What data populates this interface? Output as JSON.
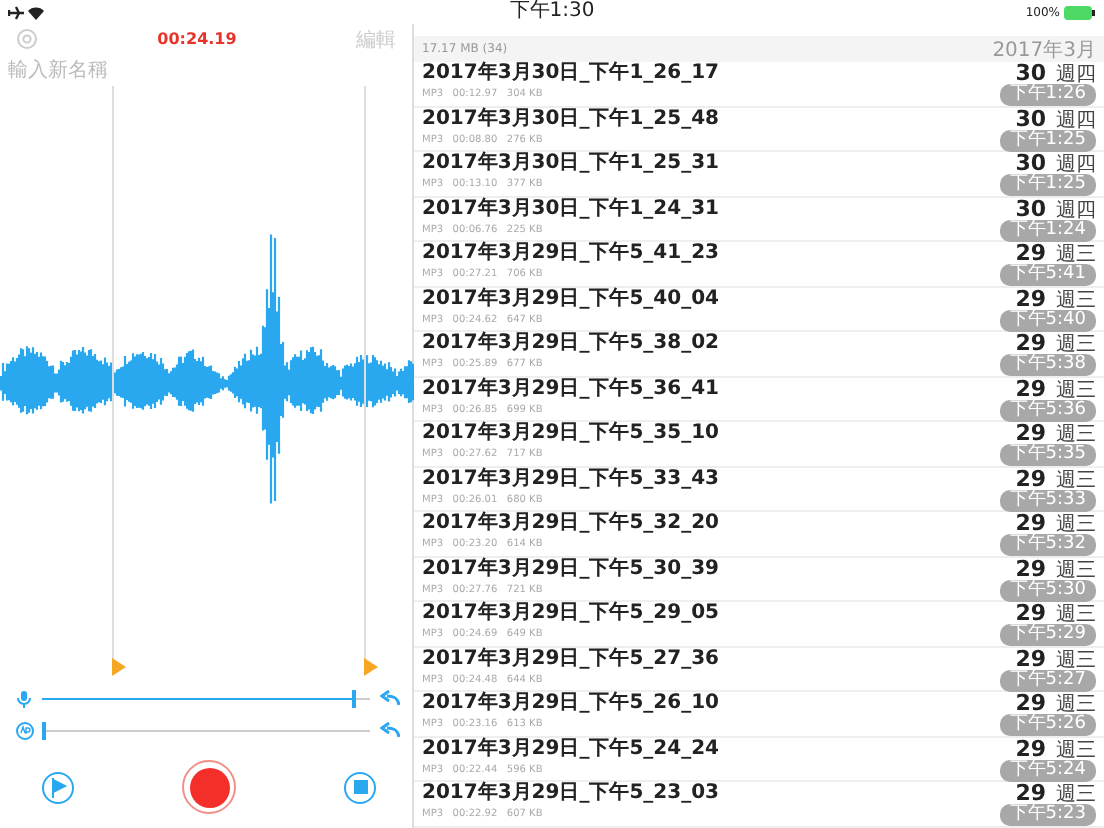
{
  "status_bar": {
    "time": "下午1:30",
    "battery": "100%"
  },
  "recorder": {
    "elapsed": "00:24.19",
    "edit": "編輯",
    "name_placeholder": "輸入新名稱",
    "sliders": [
      {
        "kind": "mic",
        "level": 0.95
      },
      {
        "kind": "ap",
        "level": 0
      }
    ]
  },
  "list": {
    "summary": "17.17 MB (34)",
    "month": "2017年3月",
    "recordings": [
      {
        "title": "2017年3月30日_下午1_26_17",
        "format": "MP3",
        "duration": "00:12.97",
        "size": "304 KB",
        "day": "30",
        "weekday": "週四",
        "time": "下午1:26"
      },
      {
        "title": "2017年3月30日_下午1_25_48",
        "format": "MP3",
        "duration": "00:08.80",
        "size": "276 KB",
        "day": "30",
        "weekday": "週四",
        "time": "下午1:25"
      },
      {
        "title": "2017年3月30日_下午1_25_31",
        "format": "MP3",
        "duration": "00:13.10",
        "size": "377 KB",
        "day": "30",
        "weekday": "週四",
        "time": "下午1:25"
      },
      {
        "title": "2017年3月30日_下午1_24_31",
        "format": "MP3",
        "duration": "00:06.76",
        "size": "225 KB",
        "day": "30",
        "weekday": "週四",
        "time": "下午1:24"
      },
      {
        "title": "2017年3月29日_下午5_41_23",
        "format": "MP3",
        "duration": "00:27.21",
        "size": "706 KB",
        "day": "29",
        "weekday": "週三",
        "time": "下午5:41"
      },
      {
        "title": "2017年3月29日_下午5_40_04",
        "format": "MP3",
        "duration": "00:24.62",
        "size": "647 KB",
        "day": "29",
        "weekday": "週三",
        "time": "下午5:40"
      },
      {
        "title": "2017年3月29日_下午5_38_02",
        "format": "MP3",
        "duration": "00:25.89",
        "size": "677 KB",
        "day": "29",
        "weekday": "週三",
        "time": "下午5:38"
      },
      {
        "title": "2017年3月29日_下午5_36_41",
        "format": "MP3",
        "duration": "00:26.85",
        "size": "699 KB",
        "day": "29",
        "weekday": "週三",
        "time": "下午5:36"
      },
      {
        "title": "2017年3月29日_下午5_35_10",
        "format": "MP3",
        "duration": "00:27.62",
        "size": "717 KB",
        "day": "29",
        "weekday": "週三",
        "time": "下午5:35"
      },
      {
        "title": "2017年3月29日_下午5_33_43",
        "format": "MP3",
        "duration": "00:26.01",
        "size": "680 KB",
        "day": "29",
        "weekday": "週三",
        "time": "下午5:33"
      },
      {
        "title": "2017年3月29日_下午5_32_20",
        "format": "MP3",
        "duration": "00:23.20",
        "size": "614 KB",
        "day": "29",
        "weekday": "週三",
        "time": "下午5:32"
      },
      {
        "title": "2017年3月29日_下午5_30_39",
        "format": "MP3",
        "duration": "00:27.76",
        "size": "721 KB",
        "day": "29",
        "weekday": "週三",
        "time": "下午5:30"
      },
      {
        "title": "2017年3月29日_下午5_29_05",
        "format": "MP3",
        "duration": "00:24.69",
        "size": "649 KB",
        "day": "29",
        "weekday": "週三",
        "time": "下午5:29"
      },
      {
        "title": "2017年3月29日_下午5_27_36",
        "format": "MP3",
        "duration": "00:24.48",
        "size": "644 KB",
        "day": "29",
        "weekday": "週三",
        "time": "下午5:27"
      },
      {
        "title": "2017年3月29日_下午5_26_10",
        "format": "MP3",
        "duration": "00:23.16",
        "size": "613 KB",
        "day": "29",
        "weekday": "週三",
        "time": "下午5:26"
      },
      {
        "title": "2017年3月29日_下午5_24_24",
        "format": "MP3",
        "duration": "00:22.44",
        "size": "596 KB",
        "day": "29",
        "weekday": "週三",
        "time": "下午5:24"
      },
      {
        "title": "2017年3月29日_下午5_23_03",
        "format": "MP3",
        "duration": "00:22.92",
        "size": "607 KB",
        "day": "29",
        "weekday": "週三",
        "time": "下午5:23"
      }
    ]
  }
}
